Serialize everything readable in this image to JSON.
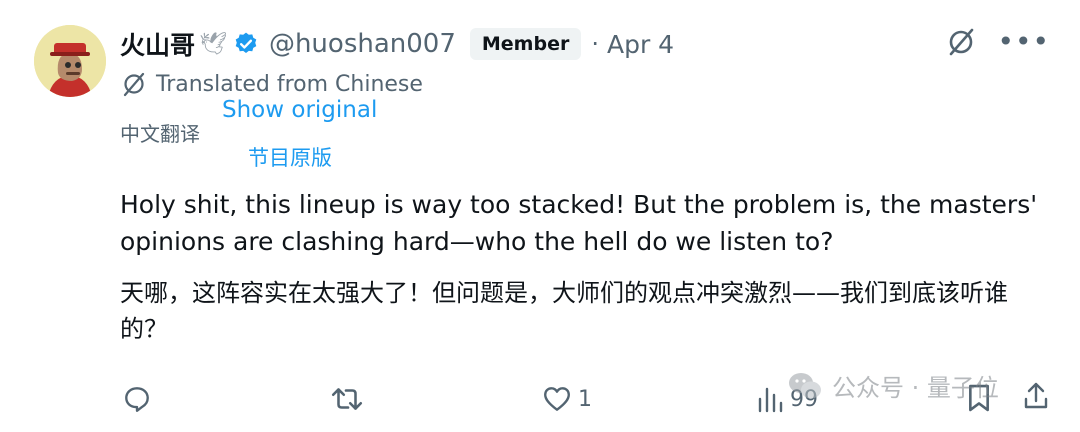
{
  "post": {
    "author": {
      "display_name": "火山哥",
      "dove_icon": "🕊",
      "handle": "@huoshan007",
      "badge": "Member",
      "verified": true
    },
    "separator": "·",
    "date": "Apr 4",
    "more_label": "•••",
    "translation": {
      "label": "Translated from Chinese",
      "label_cn": "中文翻译",
      "show_original": "Show original",
      "show_original_cn": "节目原版"
    },
    "text_en": "Holy shit, this lineup is way too stacked! But the problem is, the masters' opinions are clashing hard—who the hell do we listen to?",
    "text_zh": "天哪，这阵容实在太强大了！但问题是，大师们的观点冲突激烈——我们到底该听谁的？"
  },
  "actions": {
    "reply_count": "",
    "repost_count": "",
    "like_count": "1",
    "views_count": "99"
  },
  "watermark": {
    "text": "公众号 · 量子位"
  },
  "colors": {
    "text_primary": "#0f1419",
    "text_secondary": "#536471",
    "accent": "#1d9bf0",
    "badge_bg": "#eff3f4"
  }
}
